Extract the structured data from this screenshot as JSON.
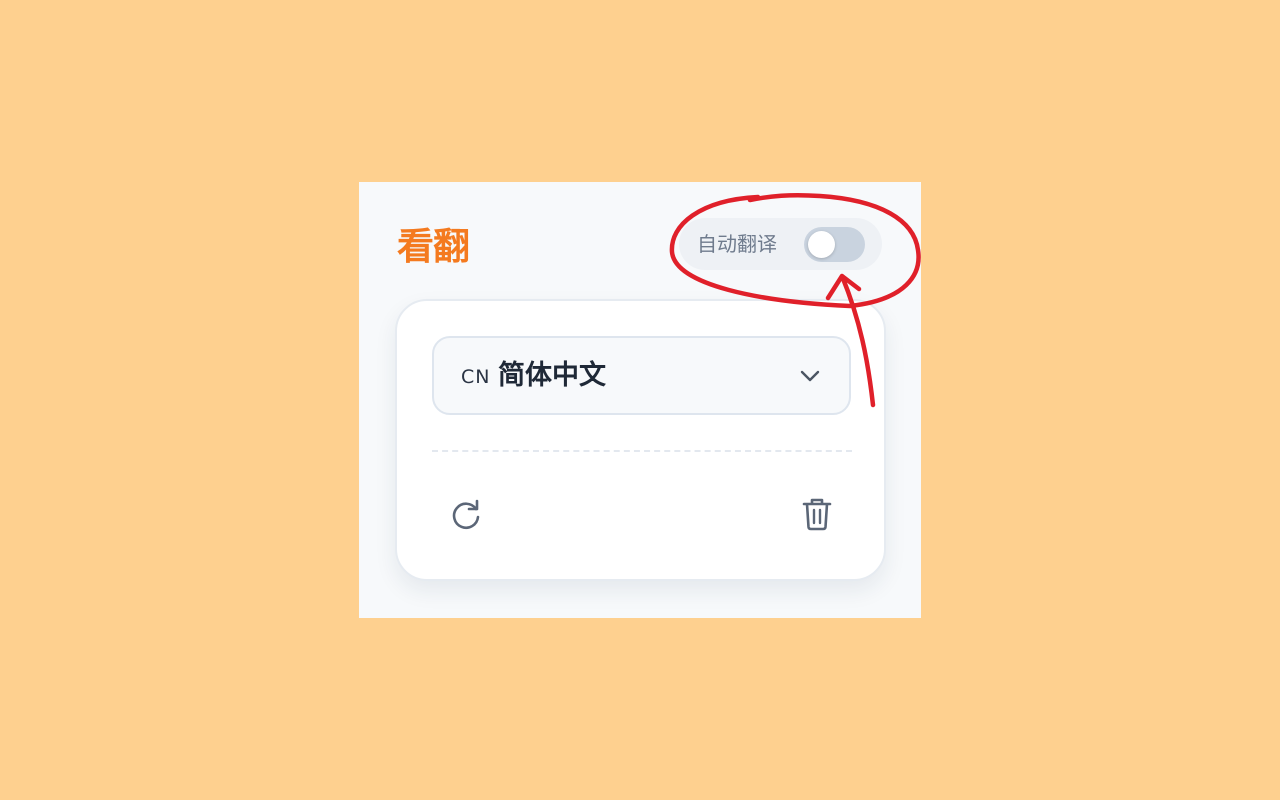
{
  "app": {
    "brand": "看翻"
  },
  "header": {
    "auto_translate_label": "自动翻译",
    "auto_translate_enabled": false
  },
  "language_select": {
    "code": "CN",
    "name": "简体中文"
  },
  "actions": {
    "refresh_icon": "refresh-icon",
    "delete_icon": "trash-icon"
  },
  "colors": {
    "background": "#FED08F",
    "brand": "#F47A1F",
    "annotation": "#E0202A",
    "toggle_off": "#C9D3DF"
  }
}
